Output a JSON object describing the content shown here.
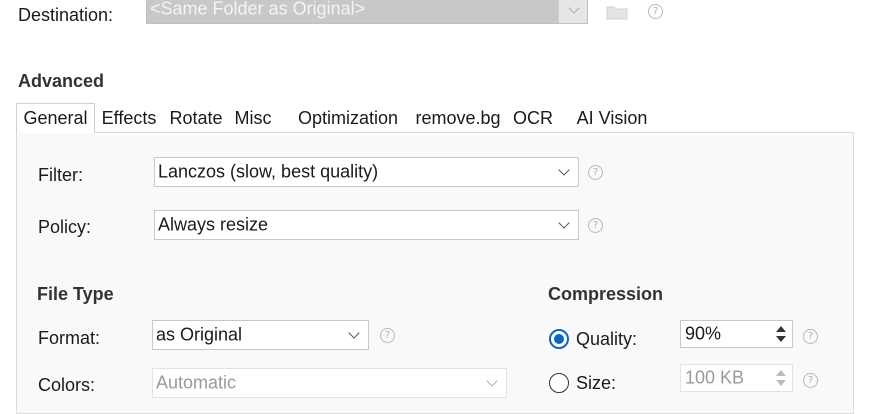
{
  "destination": {
    "label": "Destination:",
    "value": "<Same Folder as Original>"
  },
  "advanced": {
    "heading": "Advanced",
    "tabs": [
      "General",
      "Effects",
      "Rotate",
      "Misc",
      "Optimization",
      "remove.bg",
      "OCR",
      "AI Vision"
    ],
    "active_tab": "General"
  },
  "general": {
    "filter": {
      "label": "Filter:",
      "value": "Lanczos  (slow, best quality)"
    },
    "policy": {
      "label": "Policy:",
      "value": "Always resize"
    },
    "file_type": {
      "heading": "File Type",
      "format": {
        "label": "Format:",
        "value": "as Original"
      },
      "colors": {
        "label": "Colors:",
        "value": "Automatic"
      }
    },
    "compression": {
      "heading": "Compression",
      "quality": {
        "label": "Quality:",
        "value": "90%",
        "selected": true
      },
      "size": {
        "label": "Size:",
        "value": "100 KB",
        "selected": false
      }
    }
  },
  "help_glyph": "?"
}
